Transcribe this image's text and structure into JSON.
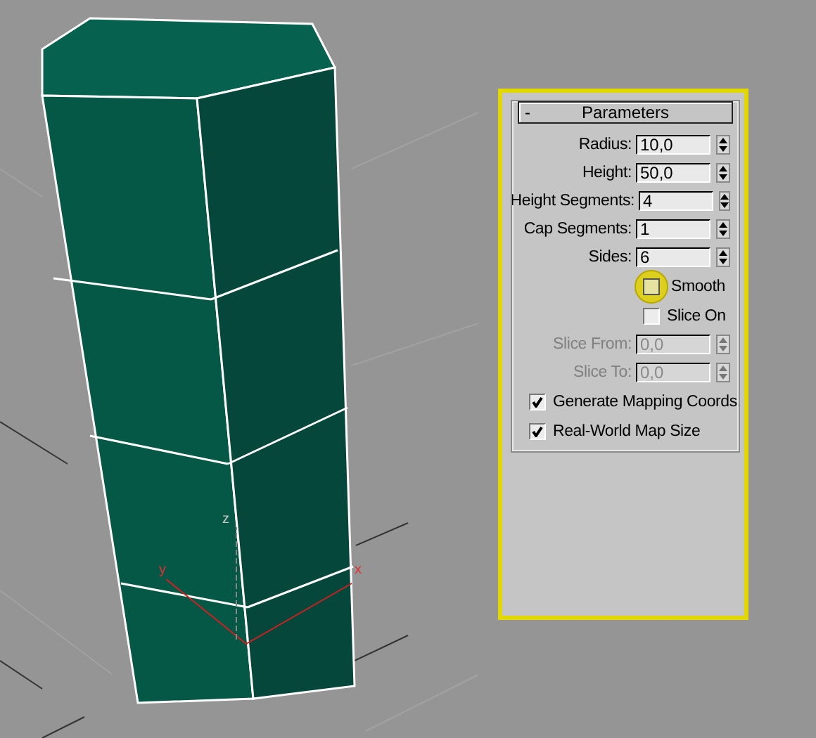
{
  "viewport": {
    "gizmo_labels": [
      "y",
      "z",
      "x"
    ]
  },
  "rollout": {
    "collapse_symbol": "-",
    "title": "Parameters"
  },
  "controls": [
    {
      "kind": "spinner",
      "label": "Radius:",
      "value": "10,0",
      "disabled": false
    },
    {
      "kind": "spinner",
      "label": "Height:",
      "value": "50,0",
      "disabled": false
    },
    {
      "kind": "spinner",
      "label": "Height Segments:",
      "value": "4",
      "disabled": false
    },
    {
      "kind": "spinner",
      "label": "Cap Segments:",
      "value": "1",
      "disabled": false
    },
    {
      "kind": "spinner",
      "label": "Sides:",
      "value": "6",
      "disabled": false
    },
    {
      "kind": "checkbox",
      "label": "Smooth",
      "checked": false,
      "highlighted": true
    },
    {
      "kind": "checkbox",
      "label": "Slice On",
      "checked": false,
      "highlighted": false
    },
    {
      "kind": "spinner",
      "label": "Slice From:",
      "value": "0,0",
      "disabled": true
    },
    {
      "kind": "spinner",
      "label": "Slice To:",
      "value": "0,0",
      "disabled": true
    },
    {
      "kind": "option",
      "label": "Generate Mapping Coords.",
      "checked": true,
      "highlighted": false
    },
    {
      "kind": "option",
      "label": "Real-World Map Size",
      "checked": true,
      "highlighted": false
    }
  ]
}
